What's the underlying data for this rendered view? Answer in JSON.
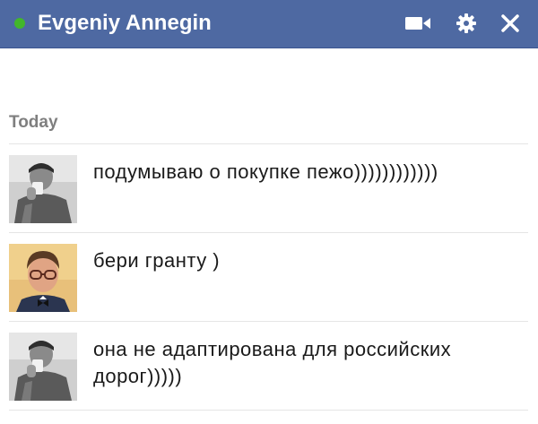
{
  "header": {
    "contact_name": "Evgeniy Annegin",
    "online_status_color": "#42b72a",
    "bar_color": "#4e69a2",
    "icons": [
      "video-camera-icon",
      "gear-icon",
      "close-icon"
    ]
  },
  "conversation": {
    "date_label": "Today",
    "messages": [
      {
        "sender_avatar": "avatar-evgeniy",
        "text": "подумываю о покупке пежо))))))))))))"
      },
      {
        "sender_avatar": "avatar-other",
        "text": "бери гранту )"
      },
      {
        "sender_avatar": "avatar-evgeniy",
        "text": "она не адаптирована для российских дорог)))))"
      }
    ]
  }
}
